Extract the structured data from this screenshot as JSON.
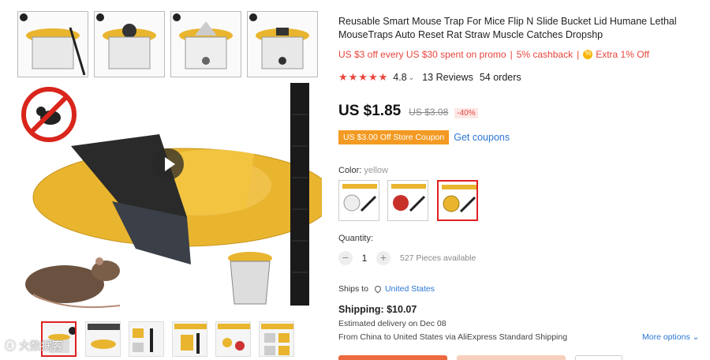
{
  "product": {
    "title": "Reusable Smart Mouse Trap For Mice Flip N Slide Bucket Lid Humane Lethal MouseTraps Auto Reset Rat Straw Muscle Catches Dropshp",
    "promo": {
      "text": "US $3 off every US $30 spent on promo",
      "cashback": "5% cashback",
      "extra": "Extra 1% Off",
      "separator": "|"
    },
    "rating": {
      "stars": 5,
      "value": "4.8",
      "reviews": "13 Reviews",
      "orders": "54 orders"
    },
    "price": {
      "current": "US $1.85",
      "original": "US $3.08",
      "discount": "-40%"
    },
    "coupon": {
      "badge": "US $3.00 Off Store Coupon",
      "link": "Get coupons"
    },
    "color": {
      "label": "Color:",
      "selected": "yellow",
      "options": [
        "white",
        "red",
        "yellow"
      ]
    },
    "quantity": {
      "label": "Quantity:",
      "minus": "−",
      "value": "1",
      "plus": "+",
      "available": "527 Pieces available"
    },
    "shipping": {
      "ships_to_label": "Ships to",
      "ships_to": "United States",
      "cost": "Shipping: $10.07",
      "delivery": "Estimated delivery on Dec 08",
      "route": "From China to United States via AliExpress Standard Shipping",
      "more_options": "More options"
    }
  },
  "gallery": {
    "steps": [
      "1",
      "2",
      "3",
      "4"
    ],
    "thumbnails": 6,
    "active_thumbnail": 0,
    "watermark": "大数据客"
  },
  "colors": {
    "accent": "#e8453c",
    "link": "#2b76d3",
    "coupon": "#f39a23",
    "trap_yellow": "#e9b52f"
  }
}
